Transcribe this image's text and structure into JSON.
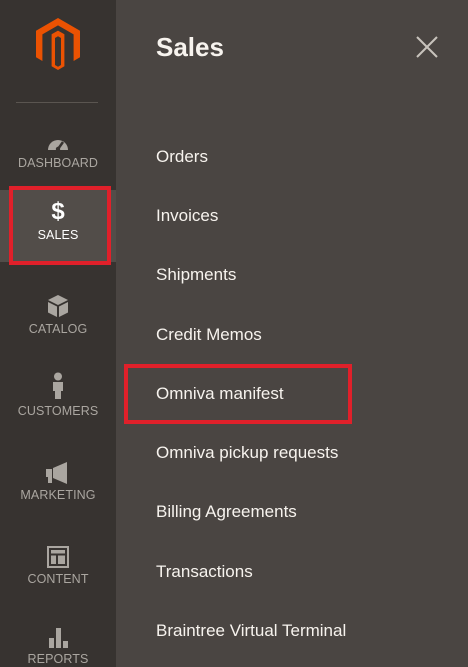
{
  "sidebar": {
    "items": [
      {
        "id": "dashboard",
        "label": "DASHBOARD",
        "icon": "dashboard-gauge-icon"
      },
      {
        "id": "sales",
        "label": "SALES",
        "icon": "dollar-icon",
        "glyph": "$",
        "active": true
      },
      {
        "id": "catalog",
        "label": "CATALOG",
        "icon": "box-icon"
      },
      {
        "id": "customers",
        "label": "CUSTOMERS",
        "icon": "person-icon"
      },
      {
        "id": "marketing",
        "label": "MARKETING",
        "icon": "megaphone-icon"
      },
      {
        "id": "content",
        "label": "CONTENT",
        "icon": "layout-icon"
      },
      {
        "id": "reports",
        "label": "REPORTS",
        "icon": "bar-chart-icon"
      }
    ]
  },
  "panel": {
    "title": "Sales",
    "close_icon": "close-icon",
    "items": [
      {
        "label": "Orders"
      },
      {
        "label": "Invoices"
      },
      {
        "label": "Shipments"
      },
      {
        "label": "Credit Memos"
      },
      {
        "label": "Omniva manifest",
        "highlighted": true
      },
      {
        "label": "Omniva pickup requests"
      },
      {
        "label": "Billing Agreements"
      },
      {
        "label": "Transactions"
      },
      {
        "label": "Braintree Virtual Terminal"
      }
    ]
  },
  "colors": {
    "sidebar_bg": "#373330",
    "sidebar_active_bg": "#524d49",
    "panel_bg": "#4a4542",
    "logo_orange": "#eb5202",
    "highlight_red": "#e0202a",
    "text_light": "#f7f3ee",
    "text_muted": "#aaa6a0"
  }
}
